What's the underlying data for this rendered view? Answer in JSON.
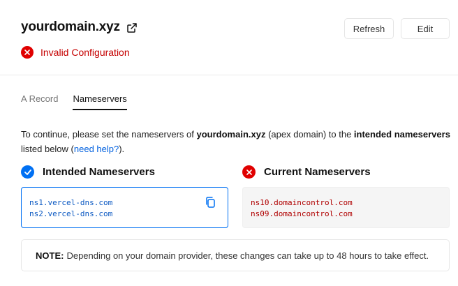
{
  "domain": {
    "name": "yourdomain.xyz",
    "status": "Invalid Configuration"
  },
  "actions": {
    "refresh_label": "Refresh",
    "edit_label": "Edit"
  },
  "tabs": [
    {
      "label": "A Record",
      "active": false
    },
    {
      "label": "Nameservers",
      "active": true
    }
  ],
  "instructions": {
    "part1": "To continue, please set the nameservers of ",
    "domain": "yourdomain.xyz",
    "part2": " (apex domain) to the ",
    "emphasis": "intended nameservers",
    "part3": " listed below (",
    "help_link": "need help?",
    "part4": ")."
  },
  "intended": {
    "title": "Intended Nameservers",
    "servers": [
      "ns1.vercel-dns.com",
      "ns2.vercel-dns.com"
    ]
  },
  "current": {
    "title": "Current Nameservers",
    "servers": [
      "ns10.domaincontrol.com",
      "ns09.domaincontrol.com"
    ]
  },
  "note": {
    "label": "NOTE:",
    "text": "Depending on your domain provider, these changes can take up to 48 hours to take effect."
  },
  "colors": {
    "accent": "#0070f3",
    "error": "#e00000"
  }
}
